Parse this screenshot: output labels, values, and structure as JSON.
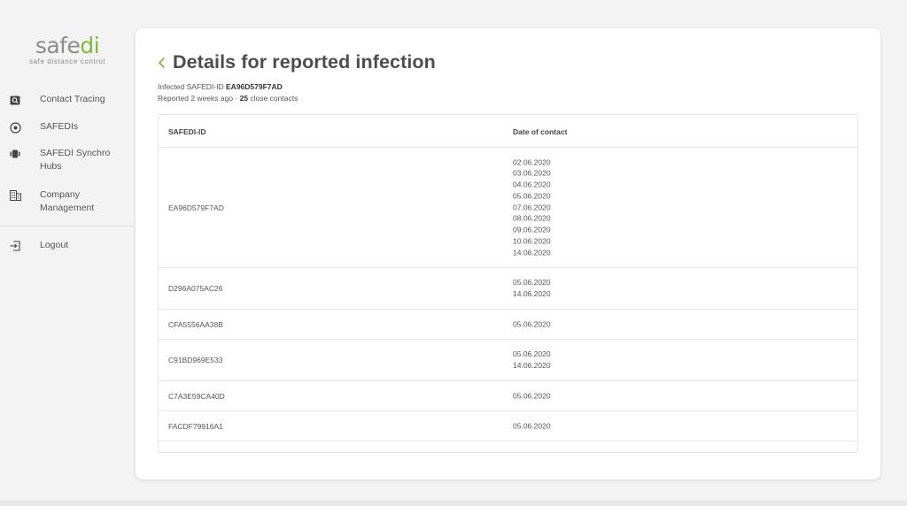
{
  "brand": {
    "logo_main": "safe",
    "logo_accent": "di",
    "tagline": "safe distance control",
    "accent_color": "#7dbb3a"
  },
  "sidebar": {
    "items": [
      {
        "label": "Contact Tracing",
        "icon": "search-icon"
      },
      {
        "label": "SAFEDIs",
        "icon": "target-icon"
      },
      {
        "label": "SAFEDI Synchro Hubs",
        "icon": "hub-icon"
      },
      {
        "label": "Company Management",
        "icon": "building-icon"
      },
      {
        "label": "Logout",
        "icon": "logout-icon"
      }
    ]
  },
  "header": {
    "title": "Details for reported infection",
    "infected_label": "Infected SAFEDI-ID",
    "infected_id": "EA96D579F7AD",
    "reported_prefix": "Reported 2 weeks ago ·",
    "contact_count": "25",
    "contact_suffix": "close contacts"
  },
  "table": {
    "columns": [
      "SAFEDI-ID",
      "Date of contact"
    ],
    "rows": [
      {
        "id": "EA96D579F7AD",
        "dates": [
          "02.06.2020",
          "03.06.2020",
          "04.06.2020",
          "05.06.2020",
          "07.06.2020",
          "08.06.2020",
          "09.06.2020",
          "10.06.2020",
          "14.06.2020"
        ]
      },
      {
        "id": "D296A075AC26",
        "dates": [
          "05.06.2020",
          "14.06.2020"
        ]
      },
      {
        "id": "CFA5556AA38B",
        "dates": [
          "05.06.2020"
        ]
      },
      {
        "id": "C91BD969E533",
        "dates": [
          "05.06.2020",
          "14.06.2020"
        ]
      },
      {
        "id": "C7A3E59CA40D",
        "dates": [
          "05.06.2020"
        ]
      },
      {
        "id": "FACDF79916A1",
        "dates": [
          "05.06.2020"
        ]
      }
    ]
  }
}
